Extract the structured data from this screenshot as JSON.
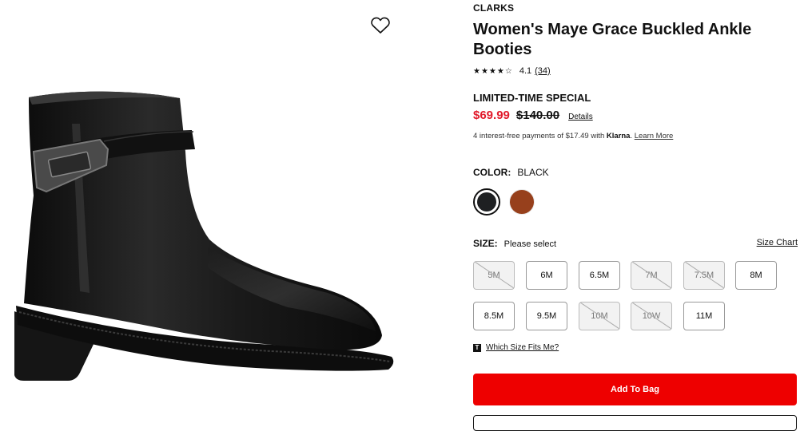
{
  "product": {
    "brand": "CLARKS",
    "title": "Women's Maye Grace Buckled Ankle Booties",
    "rating_stars": "★★★★☆",
    "rating_value": "4.1",
    "rating_count": "(34)"
  },
  "pricing": {
    "promo_label": "LIMITED-TIME SPECIAL",
    "sale_price": "$69.99",
    "original_price": "$140.00",
    "details_link": "Details",
    "klarna_prefix": "4 interest-free payments of $17.49 with ",
    "klarna_brand": "Klarna",
    "klarna_suffix": ". ",
    "klarna_learn": "Learn More"
  },
  "color": {
    "label": "COLOR:",
    "selected": "BLACK",
    "swatches": [
      {
        "name": "Black",
        "hex": "#1e2022"
      },
      {
        "name": "Brown",
        "hex": "#97401c"
      }
    ]
  },
  "size": {
    "label": "SIZE:",
    "selected": "Please select",
    "chart_link": "Size Chart",
    "options": [
      {
        "label": "5M",
        "available": false
      },
      {
        "label": "6M",
        "available": true
      },
      {
        "label": "6.5M",
        "available": true
      },
      {
        "label": "7M",
        "available": false
      },
      {
        "label": "7.5M",
        "available": false
      },
      {
        "label": "8M",
        "available": true
      },
      {
        "label": "8.5M",
        "available": true
      },
      {
        "label": "9.5M",
        "available": true
      },
      {
        "label": "10M",
        "available": false
      },
      {
        "label": "10W",
        "available": false
      },
      {
        "label": "11M",
        "available": true
      }
    ],
    "fit_icon": "T",
    "fit_link": "Which Size Fits Me?"
  },
  "actions": {
    "add_to_bag": "Add To Bag"
  },
  "colors": {
    "sale_red": "#e11a2b",
    "cta_red": "#ee0000"
  },
  "icons": {
    "wishlist": "heart-outline-icon"
  }
}
